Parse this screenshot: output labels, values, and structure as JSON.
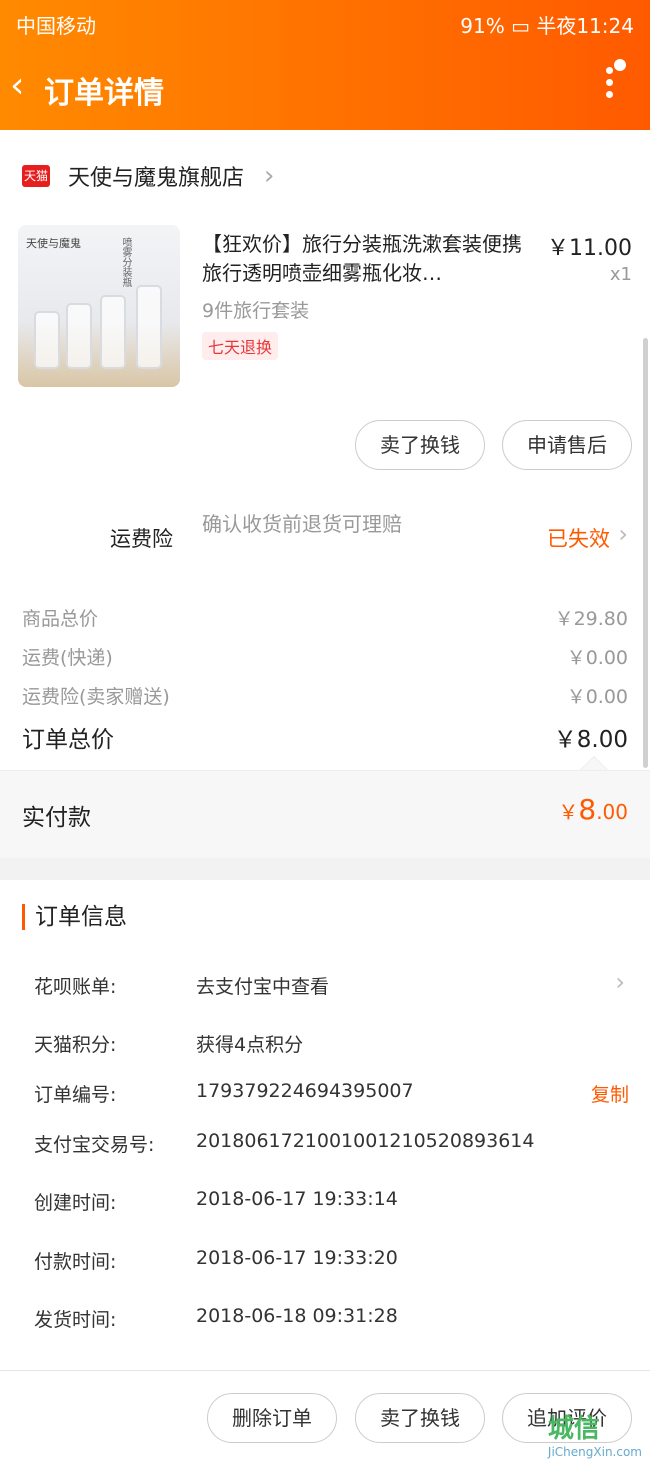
{
  "status_bar": {
    "carrier": "中国移动",
    "battery": "91%",
    "time": "半夜11:24"
  },
  "header": {
    "title": "订单详情"
  },
  "shop": {
    "badge": "天猫",
    "name": "天使与魔鬼旗舰店"
  },
  "product": {
    "title": "【狂欢价】旅行分装瓶洗漱套装便携旅行透明喷壶细雾瓶化妆…",
    "price": "￥11.00",
    "qty": "x1",
    "sku": "9件旅行套装",
    "tag": "七天退换",
    "thumb_brand": "天使与魔鬼",
    "thumb_side": "喷雾分装瓶"
  },
  "actions": {
    "sell": "卖了换钱",
    "after_sale": "申请售后"
  },
  "insurance": {
    "label": "运费险",
    "desc": "确认收货前退货可理赔",
    "status": "已失效"
  },
  "summary": {
    "goods_label": "商品总价",
    "goods_value": "￥29.80",
    "shipping_label": "运费(快递)",
    "shipping_value": "￥0.00",
    "ins_label": "运费险(卖家赠送)",
    "ins_value": "￥0.00",
    "total_label": "订单总价",
    "total_value": "￥8.00",
    "paid_label": "实付款",
    "paid_currency": "￥",
    "paid_int": "8",
    "paid_dec": ".00"
  },
  "order_info": {
    "title": "订单信息",
    "huabei_label": "花呗账单:",
    "huabei_value": "去支付宝中查看",
    "points_label": "天猫积分:",
    "points_value": "获得4点积分",
    "order_no_label": "订单编号:",
    "order_no_value": "179379224694395007",
    "copy": "复制",
    "alipay_label": "支付宝交易号:",
    "alipay_value": "2018061721001001210520893614",
    "created_label": "创建时间:",
    "created_value": "2018-06-17 19:33:14",
    "paid_label": "付款时间:",
    "paid_value": "2018-06-17 19:33:20",
    "shipped_label": "发货时间:",
    "shipped_value": "2018-06-18 09:31:28"
  },
  "footer": {
    "delete": "删除订单",
    "sell": "卖了换钱",
    "review": "追加评价"
  },
  "watermark": {
    "cn": "城信",
    "en": "JiChengXin.com"
  }
}
